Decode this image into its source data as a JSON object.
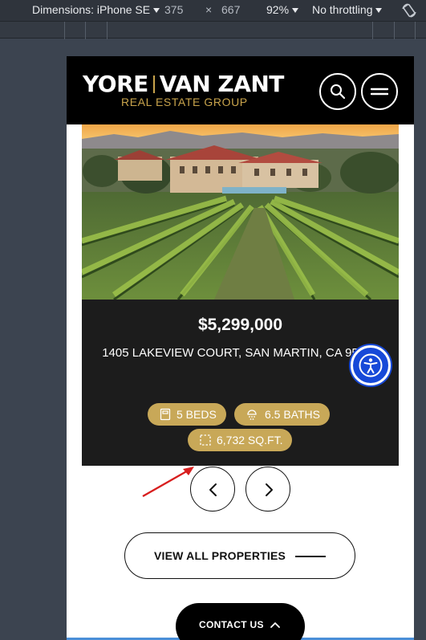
{
  "devtools": {
    "device_label": "Dimensions: iPhone SE",
    "width": "375",
    "times": "×",
    "height": "667",
    "zoom": "92%",
    "throttle": "No throttling"
  },
  "header": {
    "logo_part1": "YORE",
    "logo_part2": "VAN ZANT",
    "logo_subtitle": "REAL ESTATE GROUP"
  },
  "listing": {
    "price": "$5,299,000",
    "address": "1405 LAKEVIEW COURT, SAN MARTIN, CA 95046",
    "beds": "5 BEDS",
    "baths": "6.5 BATHS",
    "sqft": "6,732 SQ.FT."
  },
  "actions": {
    "view_all": "VIEW ALL PROPERTIES",
    "contact": "CONTACT US"
  },
  "colors": {
    "gold": "#c9a44c",
    "chip": "#c8a858",
    "accessibility_blue": "#1749d8",
    "annotation_arrow": "#d81e1e"
  }
}
